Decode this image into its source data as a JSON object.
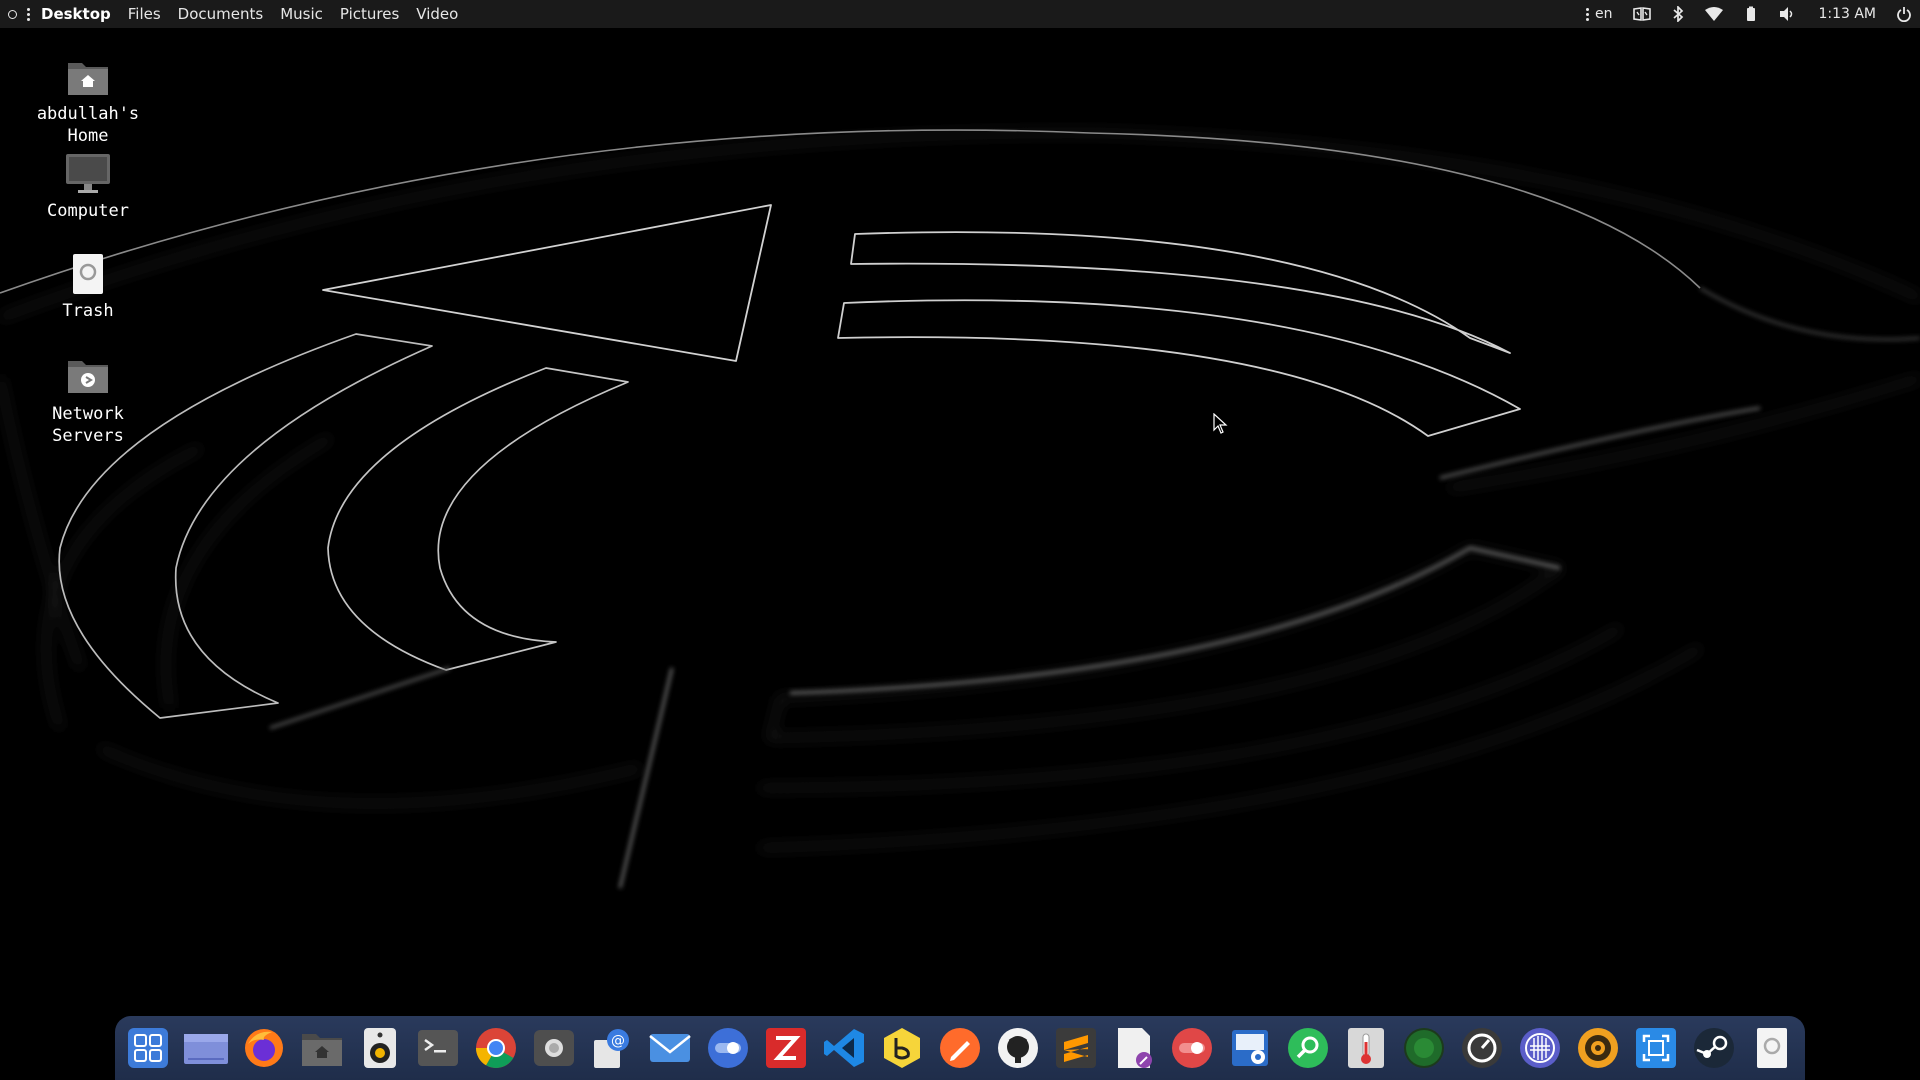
{
  "top_panel": {
    "menus": [
      "Desktop",
      "Files",
      "Documents",
      "Music",
      "Pictures",
      "Video"
    ],
    "active_menu": "Desktop",
    "language": "en",
    "clock": "1:13 AM",
    "tray_icons": [
      "keyboard-layout-icon",
      "bluetooth-icon",
      "wifi-icon",
      "battery-icon",
      "volume-icon",
      "power-icon"
    ]
  },
  "desktop_icons": [
    {
      "label": "abdullah's\nHome",
      "icon": "home-folder-icon"
    },
    {
      "label": "Computer",
      "icon": "computer-icon"
    },
    {
      "label": "Trash",
      "icon": "trash-icon"
    },
    {
      "label": "Network\nServers",
      "icon": "network-folder-icon"
    }
  ],
  "dock": {
    "apps": [
      "app-grid",
      "files-manager",
      "firefox",
      "home-folder",
      "rhythmbox",
      "terminal",
      "chrome",
      "camera",
      "mail-client",
      "mail",
      "toggle",
      "filezilla",
      "vscode",
      "bitwarden",
      "pencil",
      "github",
      "sublime-text",
      "document-editor",
      "record",
      "disk-utility",
      "search",
      "thermometer",
      "system-monitor",
      "speedometer",
      "grid-app",
      "audio",
      "screenshot",
      "steam",
      "trash"
    ]
  },
  "colors": {
    "panel_bg": "#1a1a1a",
    "dock_bg": "#243556",
    "wallpaper_bg": "#000000",
    "wallpaper_lines": "#cfcfcf"
  }
}
